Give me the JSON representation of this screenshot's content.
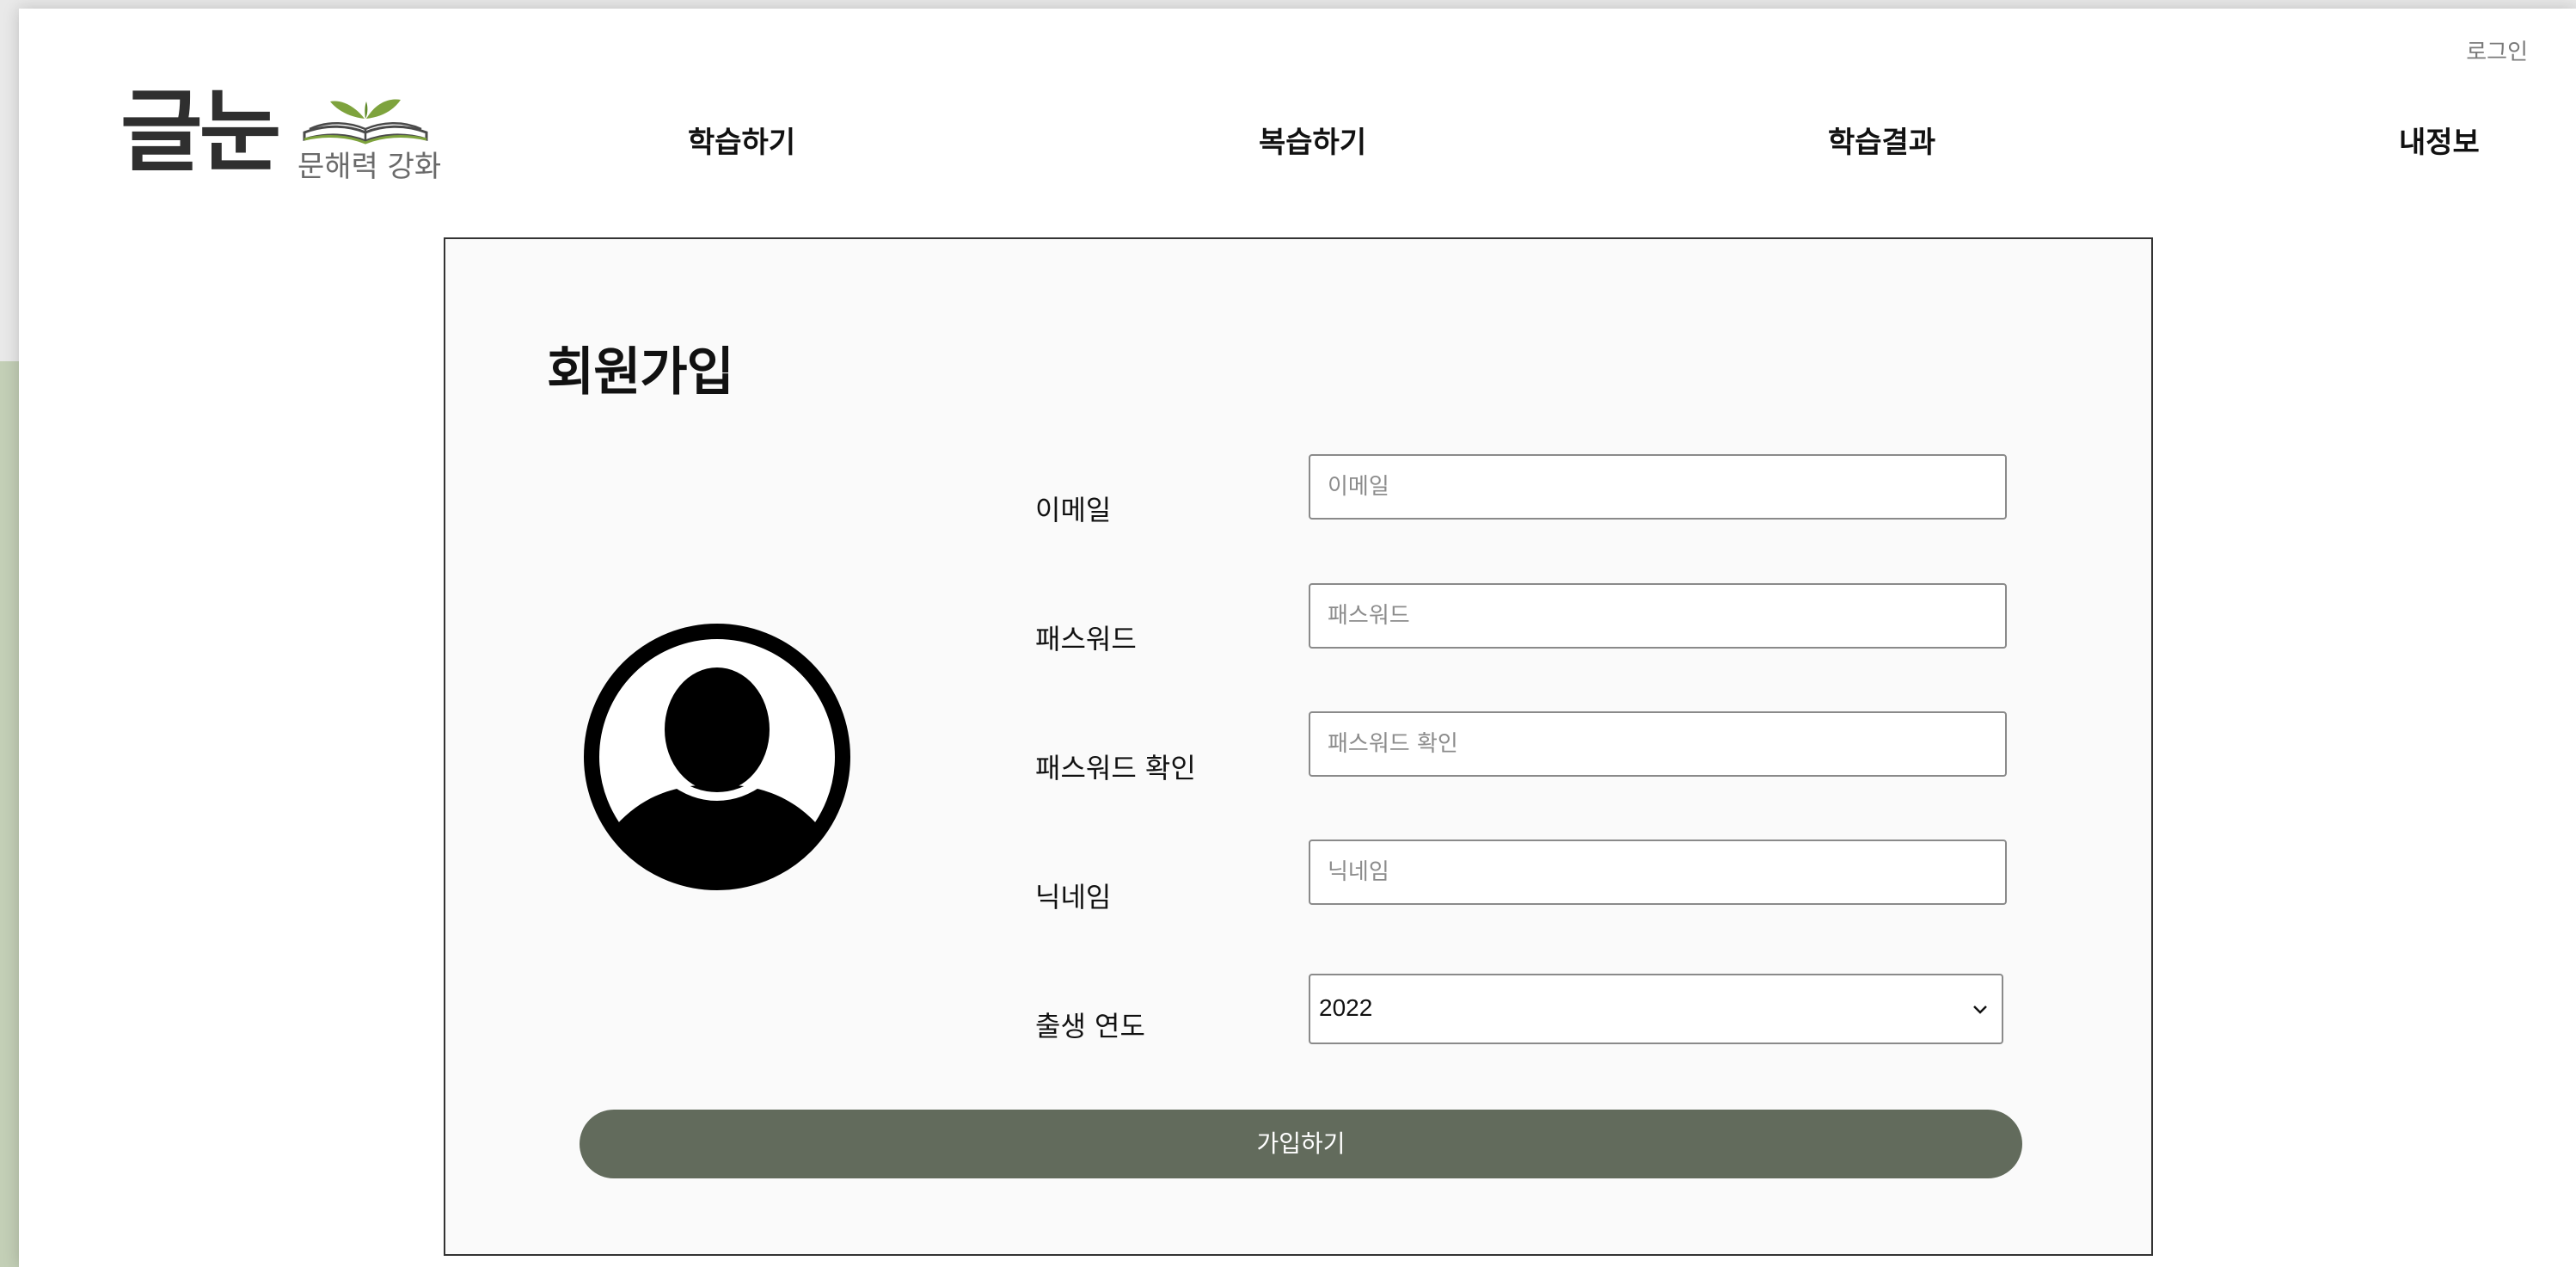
{
  "header": {
    "login_link": "로그인",
    "logo": {
      "main_text": "글눈",
      "sub_text": "문해력 강화"
    },
    "nav": [
      {
        "label": "학습하기"
      },
      {
        "label": "복습하기"
      },
      {
        "label": "학습결과"
      },
      {
        "label": "내정보"
      }
    ]
  },
  "form": {
    "title": "회원가입",
    "avatar_icon": "user-avatar-icon",
    "fields": [
      {
        "label": "이메일",
        "placeholder": "이메일",
        "value": ""
      },
      {
        "label": "패스워드",
        "placeholder": "패스워드",
        "value": ""
      },
      {
        "label": "패스워드 확인",
        "placeholder": "패스워드 확인",
        "value": ""
      },
      {
        "label": "닉네임",
        "placeholder": "닉네임",
        "value": ""
      }
    ],
    "birth_year": {
      "label": "출생 연도",
      "selected": "2022"
    },
    "submit_label": "가입하기"
  },
  "colors": {
    "accent_button": "#626b5c",
    "page_background_green": "#c3cfb6",
    "logo_leaf_green": "#7ea33d"
  }
}
